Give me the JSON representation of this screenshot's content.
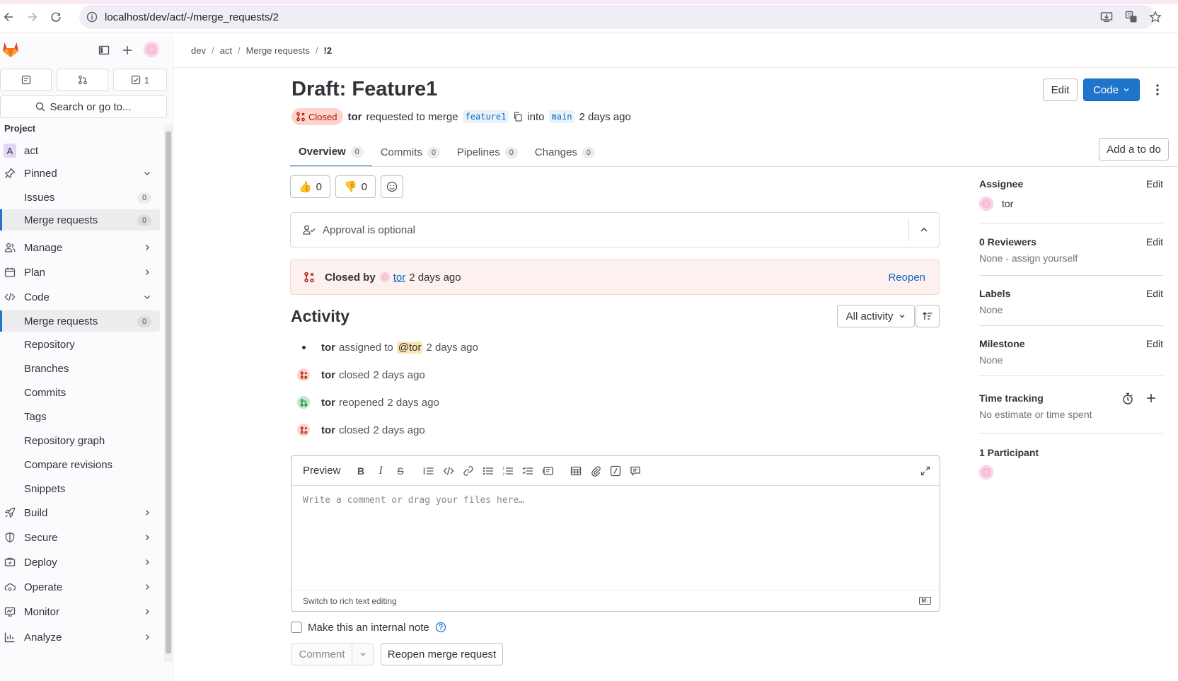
{
  "browser": {
    "url": "localhost/dev/act/-/merge_requests/2"
  },
  "sidebar": {
    "counts": [
      {
        "icon": "issues-icon",
        "label": ""
      },
      {
        "icon": "merge-request-icon",
        "label": ""
      },
      {
        "icon": "todo-icon",
        "label": "1"
      }
    ],
    "search": "Search or go to...",
    "section_label": "Project",
    "project_letter": "A",
    "project_name": "act",
    "items": [
      {
        "label": "Pinned"
      },
      {
        "label": "Issues",
        "count": "0"
      },
      {
        "label": "Merge requests",
        "count": "0"
      },
      {
        "label": "Manage"
      },
      {
        "label": "Plan"
      },
      {
        "label": "Code"
      },
      {
        "label": "Merge requests",
        "count": "0"
      },
      {
        "label": "Repository"
      },
      {
        "label": "Branches"
      },
      {
        "label": "Commits"
      },
      {
        "label": "Tags"
      },
      {
        "label": "Repository graph"
      },
      {
        "label": "Compare revisions"
      },
      {
        "label": "Snippets"
      },
      {
        "label": "Build"
      },
      {
        "label": "Secure"
      },
      {
        "label": "Deploy"
      },
      {
        "label": "Operate"
      },
      {
        "label": "Monitor"
      },
      {
        "label": "Analyze"
      }
    ]
  },
  "breadcrumb": [
    "dev",
    "act",
    "Merge requests",
    "!2"
  ],
  "header": {
    "title": "Draft: Feature1",
    "edit_label": "Edit",
    "code_label": "Code",
    "status": "Closed",
    "author": "tor",
    "requested_text": "requested to merge",
    "source_branch": "feature1",
    "into_text": "into",
    "target_branch": "main",
    "time": "2 days ago"
  },
  "tabs": [
    {
      "label": "Overview",
      "count": "0"
    },
    {
      "label": "Commits",
      "count": "0"
    },
    {
      "label": "Pipelines",
      "count": "0"
    },
    {
      "label": "Changes",
      "count": "0"
    }
  ],
  "add_todo_label": "Add a to do",
  "reactions": {
    "thumbsup": "👍",
    "thumbsup_count": "0",
    "thumbsdown": "👎",
    "thumbsdown_count": "0"
  },
  "approval": {
    "text": "Approval is optional"
  },
  "closed_box": {
    "prefix": "Closed by",
    "user": "tor",
    "time": "2 days ago",
    "reopen": "Reopen"
  },
  "activity": {
    "title": "Activity",
    "filter": "All activity",
    "events": [
      {
        "user": "tor",
        "action": "assigned to",
        "mention": "@tor",
        "time": "2 days ago",
        "type": "assign"
      },
      {
        "user": "tor",
        "action": "closed",
        "mention": "",
        "time": "2 days ago",
        "type": "closed"
      },
      {
        "user": "tor",
        "action": "reopened",
        "mention": "",
        "time": "2 days ago",
        "type": "reopened"
      },
      {
        "user": "tor",
        "action": "closed",
        "mention": "",
        "time": "2 days ago",
        "type": "closed"
      }
    ]
  },
  "editor": {
    "preview_label": "Preview",
    "placeholder": "Write a comment or drag your files here…",
    "switch_label": "Switch to rich text editing",
    "md_badge": "M↓"
  },
  "comment_form": {
    "internal_note_label": "Make this an internal note",
    "comment_label": "Comment",
    "reopen_label": "Reopen merge request"
  },
  "right_sidebar": {
    "assignee": {
      "title": "Assignee",
      "edit": "Edit",
      "value": "tor"
    },
    "reviewers": {
      "title": "0 Reviewers",
      "edit": "Edit",
      "value": "None - assign yourself"
    },
    "labels": {
      "title": "Labels",
      "edit": "Edit",
      "value": "None"
    },
    "milestone": {
      "title": "Milestone",
      "edit": "Edit",
      "value": "None"
    },
    "time_tracking": {
      "title": "Time tracking",
      "value": "No estimate or time spent"
    },
    "participants": {
      "title": "1 Participant"
    }
  },
  "colors": {
    "accent": "#1f75cb",
    "closed": "#ae1800",
    "closed_bg": "#fdd4cd",
    "reopened": "#108548"
  }
}
